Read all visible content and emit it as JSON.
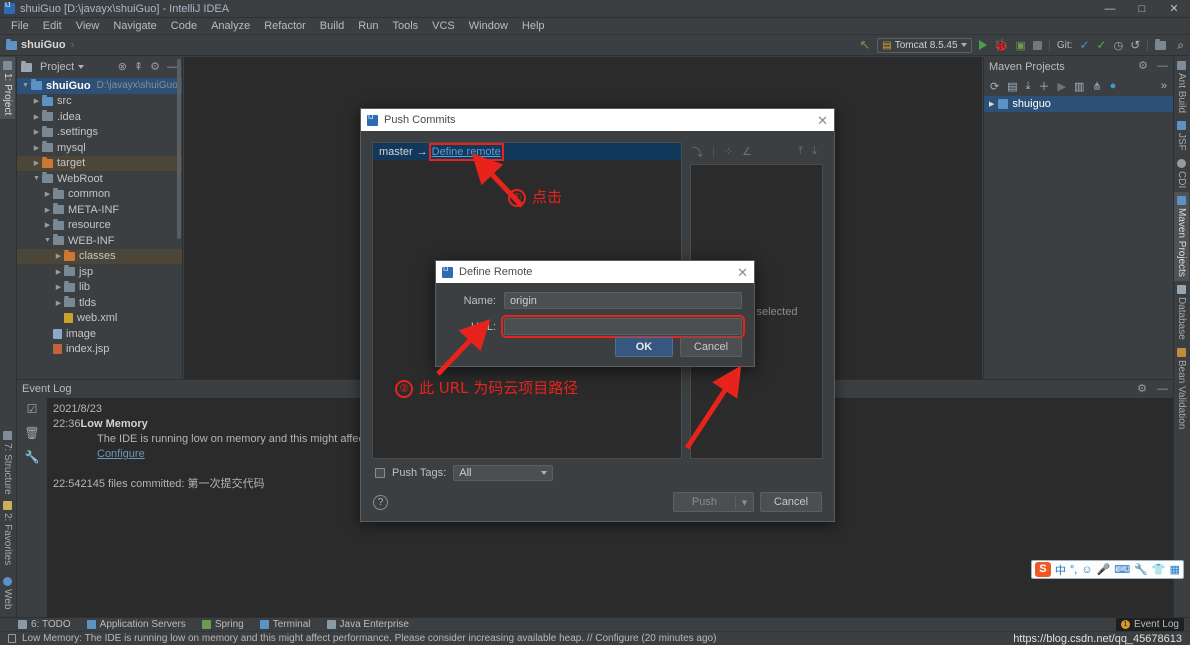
{
  "window": {
    "title": "shuiGuo [D:\\javayx\\shuiGuo] - IntelliJ IDEA",
    "minimize": "—",
    "maximize": "□",
    "close": "✕"
  },
  "menu": [
    "File",
    "Edit",
    "View",
    "Navigate",
    "Code",
    "Analyze",
    "Refactor",
    "Build",
    "Run",
    "Tools",
    "VCS",
    "Window",
    "Help"
  ],
  "navbar": {
    "project_name": "shuiGuo",
    "separator": "›",
    "run_config": "Tomcat 8.5.45",
    "git_label": "Git:"
  },
  "left_tabs": [
    {
      "label": "1: Project",
      "selected": true
    },
    {
      "label": "7: Structure",
      "selected": false
    },
    {
      "label": "2: Favorites",
      "selected": false
    },
    {
      "label": "Web",
      "selected": false
    }
  ],
  "right_tabs": [
    {
      "label": "Ant Build",
      "selected": false
    },
    {
      "label": "JSF",
      "selected": false
    },
    {
      "label": "CDI",
      "selected": false
    },
    {
      "label": "Maven Projects",
      "selected": true
    },
    {
      "label": "Database",
      "selected": false
    },
    {
      "label": "Bean Validation",
      "selected": false
    }
  ],
  "project_panel": {
    "title": "Project",
    "tree": [
      {
        "label": "shuiGuo",
        "path": "D:\\javayx\\shuiGuo",
        "indent": 0,
        "arrow": "▼",
        "icon": "project",
        "state": "selected"
      },
      {
        "label": "src",
        "indent": 1,
        "arrow": "▶",
        "icon": "source",
        "state": "normal"
      },
      {
        "label": ".idea",
        "indent": 1,
        "arrow": "▶",
        "icon": "folder",
        "state": "normal"
      },
      {
        "label": ".settings",
        "indent": 1,
        "arrow": "▶",
        "icon": "folder",
        "state": "normal"
      },
      {
        "label": "mysql",
        "indent": 1,
        "arrow": "▶",
        "icon": "folder",
        "state": "normal"
      },
      {
        "label": "target",
        "indent": 1,
        "arrow": "▶",
        "icon": "excluded",
        "state": "highlight"
      },
      {
        "label": "WebRoot",
        "indent": 1,
        "arrow": "▼",
        "icon": "folder",
        "state": "normal"
      },
      {
        "label": "common",
        "indent": 2,
        "arrow": "▶",
        "icon": "folder",
        "state": "normal"
      },
      {
        "label": "META-INF",
        "indent": 2,
        "arrow": "▶",
        "icon": "folder",
        "state": "normal"
      },
      {
        "label": "resource",
        "indent": 2,
        "arrow": "▶",
        "icon": "folder",
        "state": "normal"
      },
      {
        "label": "WEB-INF",
        "indent": 2,
        "arrow": "▼",
        "icon": "folder",
        "state": "normal"
      },
      {
        "label": "classes",
        "indent": 3,
        "arrow": "▶",
        "icon": "excluded",
        "state": "highlight"
      },
      {
        "label": "jsp",
        "indent": 3,
        "arrow": "▶",
        "icon": "folder",
        "state": "normal"
      },
      {
        "label": "lib",
        "indent": 3,
        "arrow": "▶",
        "icon": "folder",
        "state": "normal"
      },
      {
        "label": "tlds",
        "indent": 3,
        "arrow": "▶",
        "icon": "folder",
        "state": "normal"
      },
      {
        "label": "web.xml",
        "indent": 3,
        "arrow": "",
        "icon": "xml",
        "state": "normal"
      },
      {
        "label": "image",
        "indent": 2,
        "arrow": "",
        "icon": "image",
        "state": "normal"
      },
      {
        "label": "index.jsp",
        "indent": 2,
        "arrow": "",
        "icon": "jsp",
        "state": "normal"
      }
    ]
  },
  "maven_panel": {
    "title": "Maven Projects",
    "root": "shuiguo"
  },
  "event_log": {
    "title": "Event Log",
    "date": "2021/8/23",
    "entries": [
      {
        "time": "22:36",
        "title": "Low Memory",
        "body": "The IDE is running low on memory and this might affect performanc",
        "link": "Configure"
      },
      {
        "time": "22:54",
        "title": "2145 files committed: 第一次提交代码",
        "body": "",
        "link": ""
      }
    ]
  },
  "push_dialog": {
    "title": "Push Commits",
    "branch": "master",
    "arrow": "→",
    "define_remote_link": "Define remote",
    "nothing_selected": "Nothing selected",
    "push_tags_label": "Push Tags:",
    "push_tags_value": "All",
    "help": "?",
    "push_button": "Push",
    "cancel_button": "Cancel",
    "close": "✕"
  },
  "remote_dialog": {
    "title": "Define Remote",
    "name_label": "Name:",
    "name_value": "origin",
    "url_label": "URL:",
    "url_value": "",
    "ok_button": "OK",
    "cancel_button": "Cancel",
    "close": "✕"
  },
  "annotations": [
    {
      "number": "①",
      "text": "点击"
    },
    {
      "number": "②",
      "text": "此 URL 为码云项目路径"
    }
  ],
  "tool_window_bar": [
    {
      "label": "6: TODO"
    },
    {
      "label": "Application Servers"
    },
    {
      "label": "Spring"
    },
    {
      "label": "Terminal"
    },
    {
      "label": "Java Enterprise"
    }
  ],
  "event_log_button": {
    "badge": "1",
    "label": "Event Log"
  },
  "statusbar": {
    "message": "Low Memory: The IDE is running low on memory and this might affect performance. Please consider increasing available heap. // Configure (20 minutes ago)",
    "watermark": "https://blog.csdn.net/qq_45678613"
  },
  "ime": {
    "logo": "S",
    "mode": "中",
    "items": [
      "°,",
      "☺",
      "🎤",
      "⌨",
      "🔧",
      "👕",
      "▦"
    ]
  },
  "colors": {
    "panel_bg": "#3c3f41",
    "editor_bg": "#2b2b2b",
    "selection_blue": "#2d5176",
    "accent_red": "#e8231b",
    "link_blue": "#6897bb",
    "ok_button": "#365880"
  }
}
